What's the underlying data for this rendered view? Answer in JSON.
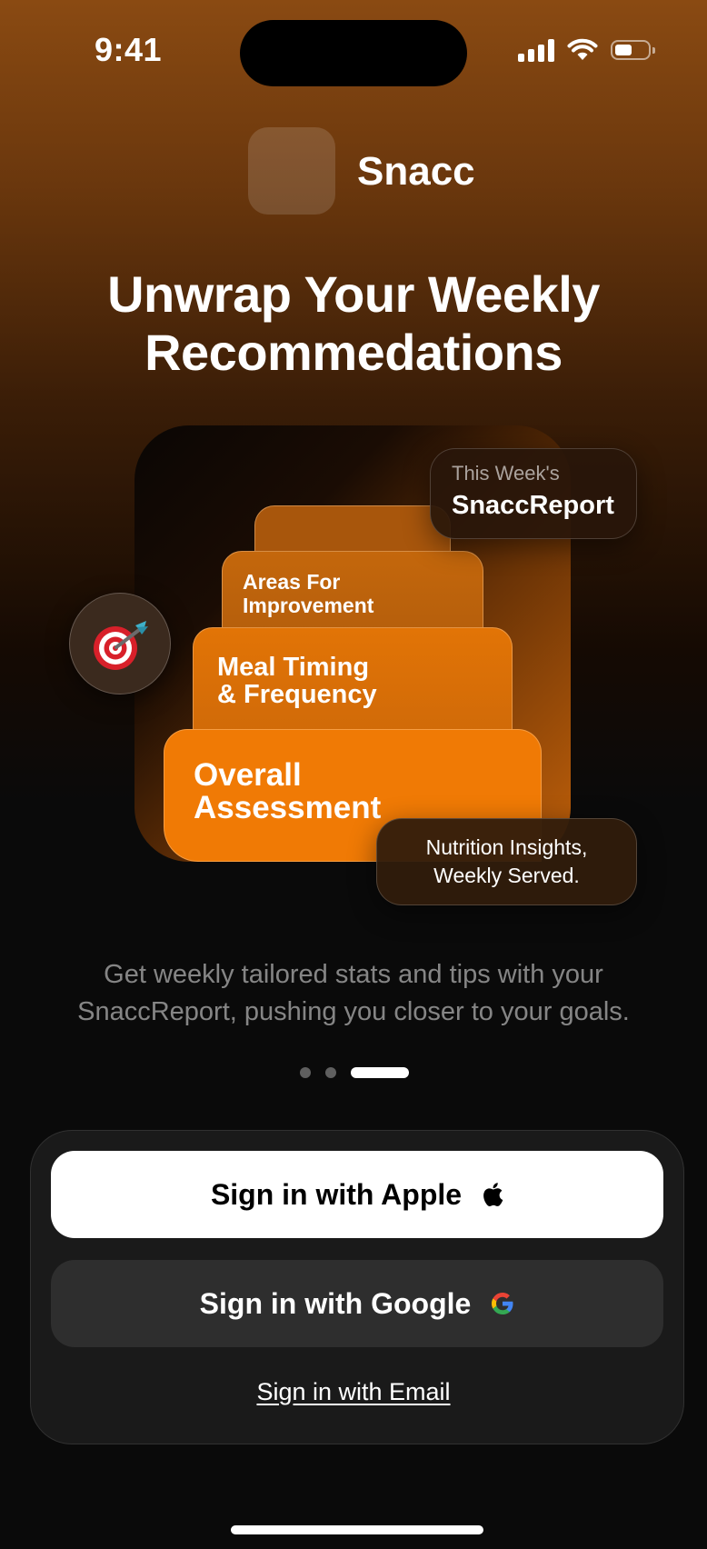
{
  "status_bar": {
    "time": "9:41"
  },
  "header": {
    "app_name": "Snacc",
    "headline_line1": "Unwrap Your Weekly",
    "headline_line2": "Recommedations"
  },
  "illustration": {
    "week_label": "This Week's",
    "report_label": "SnaccReport",
    "card_areas_line1": "Areas For",
    "card_areas_line2": "Improvement",
    "card_meal_line1": "Meal Timing",
    "card_meal_line2": "& Frequency",
    "card_overall_line1": "Overall",
    "card_overall_line2": "Assessment",
    "insights_line1": "Nutrition Insights,",
    "insights_line2": "Weekly Served.",
    "badge_icon": "dart-target-icon"
  },
  "description": {
    "line1": "Get weekly tailored stats and tips with your",
    "line2": "SnaccReport, pushing you closer to your goals."
  },
  "pagination": {
    "total": 3,
    "current": 3
  },
  "auth": {
    "apple_label": "Sign in with Apple",
    "google_label": "Sign in with Google",
    "email_label": "Sign in with Email"
  },
  "colors": {
    "accent": "#f07a05",
    "panel": "#1a1a1a",
    "google_button": "#2e2e2e"
  }
}
